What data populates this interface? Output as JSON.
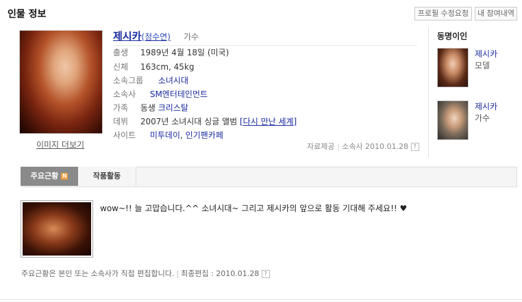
{
  "header": {
    "title": "인물 정보",
    "btn_edit_request": "프로필 수정요청",
    "btn_my_history": "내 참여내역"
  },
  "profile": {
    "name": "제시카",
    "real_name": "(정수연)",
    "job": "가수",
    "more_images": "이미지 더보기",
    "fields": {
      "birth_label": "출생",
      "birth_value": "1989년 4월 18일 (미국)",
      "body_label": "신체",
      "body_value": "163cm, 45kg",
      "group_label": "소속그룹",
      "group_value": "소녀시대",
      "agency_label": "소속사",
      "agency_value": "SM엔터테인먼트",
      "family_label": "가족",
      "family_prefix": "동생",
      "family_value": "크리스탈",
      "debut_label": "데뷔",
      "debut_prefix": "2007년 소녀시대 싱글 앨범",
      "debut_value": "[다시 만난 세계]",
      "site_label": "사이트",
      "site_1": "미투데이",
      "site_sep": ",",
      "site_2": "인기팬카페"
    },
    "source": "자료제공",
    "source_by": "소속사 2010.01.28",
    "help": "?"
  },
  "same_name": {
    "title": "동명이인",
    "items": [
      {
        "name": "제시카",
        "job": "모델"
      },
      {
        "name": "제시카",
        "job": "가수"
      }
    ]
  },
  "tabs": {
    "main_news": "주요근황",
    "new_badge": "N",
    "works": "작품활동"
  },
  "news": {
    "text": "wow~!! 늘 고맙습니다.^^ 소녀시대~ 그리고 제시카의 앞으로 활동 기대해 주세요!! ♥"
  },
  "footer": {
    "note": "주요근황은 본인 또는 소속사가 직접 편집합니다.",
    "sep": "|",
    "last_edit": "최종편집 : 2010.01.28"
  }
}
